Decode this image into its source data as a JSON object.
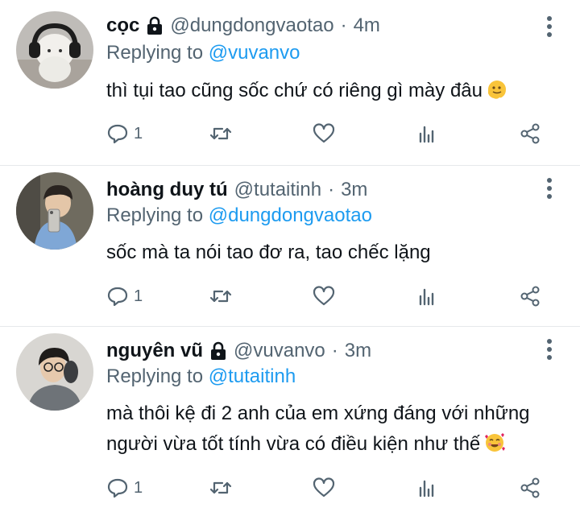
{
  "tweets": [
    {
      "display_name": "cọc",
      "verified_lock": true,
      "handle": "@dungdongvaotao",
      "time": "4m",
      "replying_prefix": "Replying to",
      "replying_to": "@vuvanvo",
      "text_lines": [
        "thì tụi tao cũng sốc chứ có riêng gì mày đâu"
      ],
      "emoji": "melting-face",
      "reply_count": "1"
    },
    {
      "display_name": "hoàng duy tú",
      "verified_lock": false,
      "handle": "@tutaitinh",
      "time": "3m",
      "replying_prefix": "Replying to",
      "replying_to": "@dungdongvaotao",
      "text_lines": [
        "sốc mà ta nói tao đơ ra, tao chếc lặng"
      ],
      "emoji": "",
      "reply_count": "1"
    },
    {
      "display_name": "nguyên vũ",
      "verified_lock": true,
      "handle": "@vuvanvo",
      "time": "3m",
      "replying_prefix": "Replying to",
      "replying_to": "@tutaitinh",
      "text_lines": [
        "mà thôi kệ đi 2 anh của em xứng đáng với những",
        "người vừa tốt tính vừa có điều kiện như thế"
      ],
      "emoji": "smiling-face-with-hearts",
      "reply_count": "1"
    }
  ],
  "separator": "·",
  "icons": {
    "reply": "reply-icon",
    "retweet": "retweet-icon",
    "like": "heart-icon",
    "views": "views-icon",
    "share": "share-icon",
    "more": "more-vertical-icon",
    "lock": "lock-icon"
  },
  "colors": {
    "text": "#0f1419",
    "secondary": "#536471",
    "accent": "#1d9bf0",
    "divider": "#e6e9eb"
  }
}
